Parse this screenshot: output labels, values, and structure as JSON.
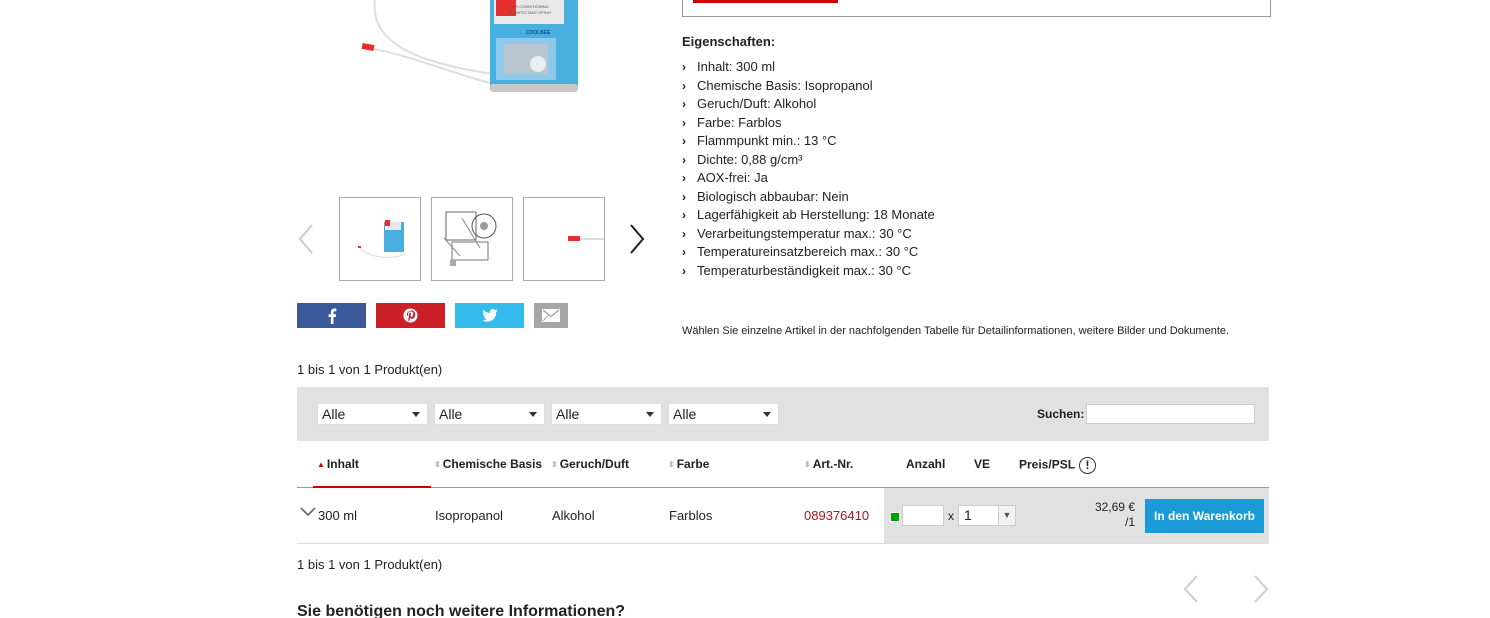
{
  "properties": {
    "title": "Eigenschaften:",
    "items": [
      "Inhalt: 300 ml",
      "Chemische Basis: Isopropanol",
      "Geruch/Duft: Alkohol",
      "Farbe: Farblos",
      "Flammpunkt min.: 13 °C",
      "Dichte: 0,88 g/cm³",
      "AOX-frei: Ja",
      "Biologisch abbaubar: Nein",
      "Lagerfähigkeit ab Herstellung: 18 Monate",
      "Verarbeitungstemperatur max.: 30 °C",
      "Temperatureinsatzbereich max.: 30 °C",
      "Temperaturbeständigkeit max.: 30 °C"
    ]
  },
  "product_image": {
    "can_text_1": "AIR CONDITIONING",
    "can_text_2": "DISINFECTANT SPRAY",
    "can_text_3": "COOLBEE"
  },
  "info_note": "Wählen Sie einzelne Artikel in der nachfolgenden Tabelle für Detailinformationen, weitere Bilder und Dokumente.",
  "count_text": "1 bis 1 von 1 Produkt(en)",
  "filters": {
    "f1": "Alle",
    "f2": "Alle",
    "f3": "Alle",
    "f4": "Alle",
    "search_label": "Suchen:"
  },
  "table": {
    "headers": {
      "inhalt": "Inhalt",
      "chem": "Chemische Basis",
      "geruch": "Geruch/Duft",
      "farbe": "Farbe",
      "art": "Art.-Nr.",
      "anzahl": "Anzahl",
      "ve": "VE",
      "preis": "Preis/PSL"
    },
    "row": {
      "inhalt": "300 ml",
      "chem": "Isopropanol",
      "geruch": "Alkohol",
      "farbe": "Farblos",
      "art": "089376410",
      "qty_x": "x",
      "ve": "1",
      "price_line1": "32,69 €",
      "price_line2": "/1",
      "cart_label": "In den Warenkorb"
    }
  },
  "more_info_title": "Sie benötigen noch weitere Informationen?",
  "colors": {
    "accent_red": "#cc0000",
    "cart_blue": "#1a9bd7",
    "facebook": "#3b5998",
    "pinterest": "#cb2027",
    "twitter": "#33bbeb",
    "mail": "#a6a6a6",
    "stock_green": "#00a000"
  },
  "icons": {
    "share": [
      "facebook-icon",
      "pinterest-icon",
      "twitter-icon",
      "mail-icon"
    ],
    "nav": [
      "chevron-left-icon",
      "chevron-right-icon"
    ],
    "info": "info-icon"
  }
}
